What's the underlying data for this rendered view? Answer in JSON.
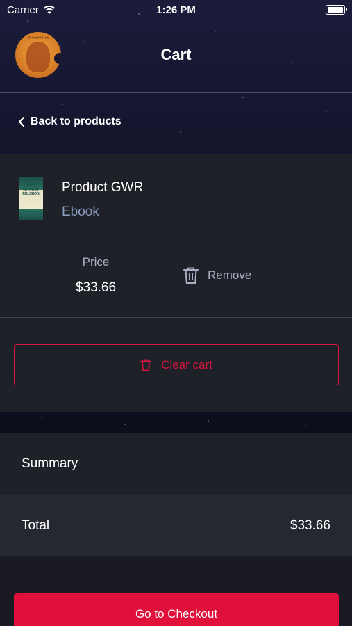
{
  "status_bar": {
    "carrier": "Carrier",
    "time": "1:26 PM"
  },
  "header": {
    "title": "Cart",
    "logo_text": "ॐ परमात्मने नमः"
  },
  "nav": {
    "back_label": "Back to products"
  },
  "cart": {
    "item": {
      "name": "Product GWR",
      "type": "Ebook",
      "thumb_title": "GOD WITHOUT RELIGION",
      "price_label": "Price",
      "price": "$33.66",
      "remove_label": "Remove"
    },
    "clear_label": "Clear cart"
  },
  "summary": {
    "title": "Summary",
    "total_label": "Total",
    "total_value": "$33.66"
  },
  "checkout": {
    "label": "Go to Checkout"
  },
  "colors": {
    "accent": "#e0103b",
    "muted_text": "#a8b0c4",
    "type_text": "#8a9bbf",
    "card_bg": "#1f2128"
  }
}
